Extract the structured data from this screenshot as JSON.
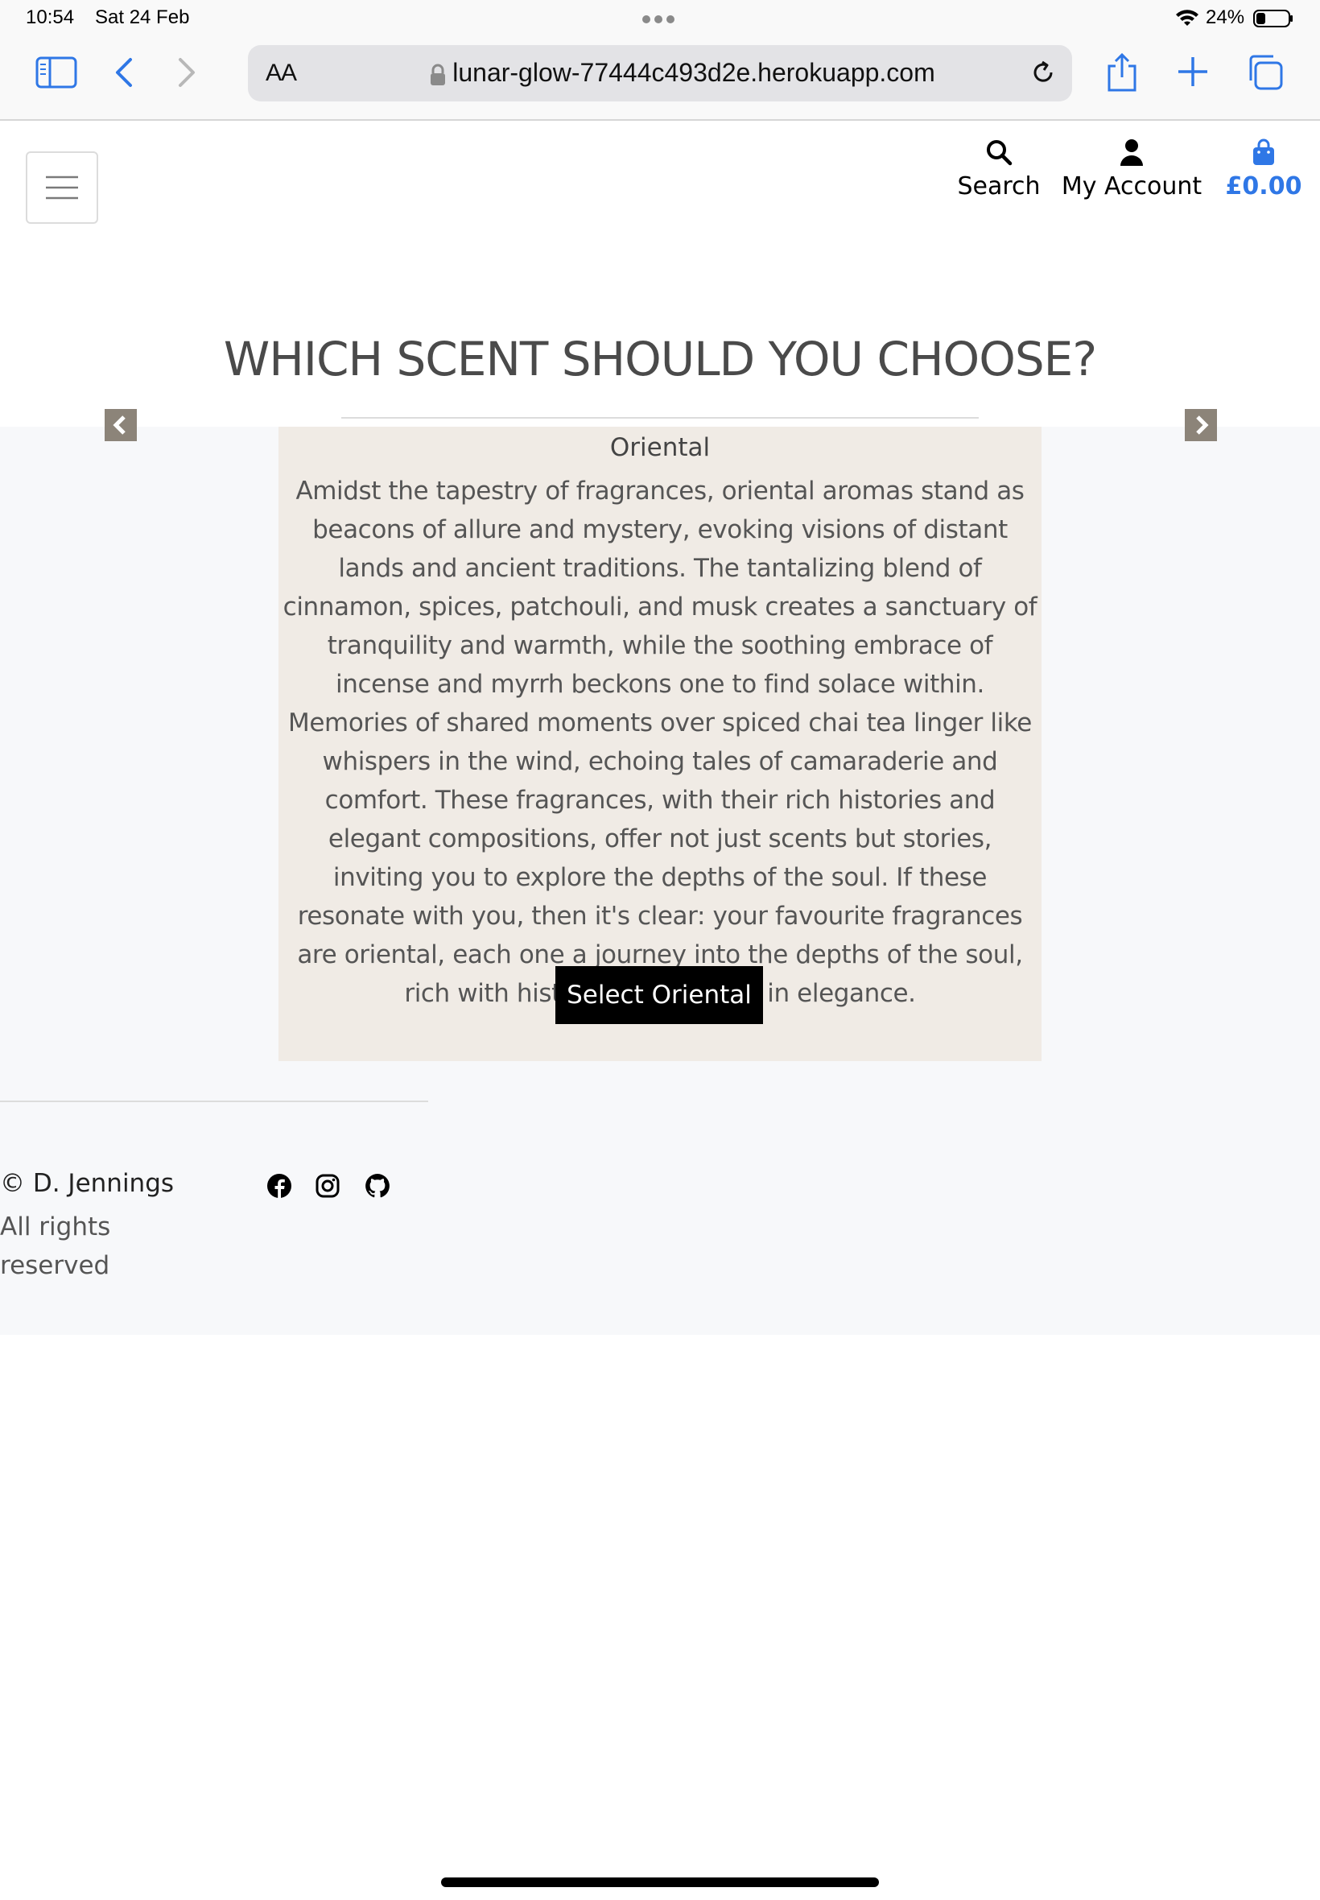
{
  "status": {
    "time": "10:54",
    "date": "Sat 24 Feb",
    "battery": "24%"
  },
  "browser": {
    "text_size_label": "AA",
    "url": "lunar-glow-77444c493d2e.herokuapp.com"
  },
  "header": {
    "search_label": "Search",
    "account_label": "My Account",
    "bag_total": "£0.00",
    "accent_color": "#2f77e6"
  },
  "main": {
    "title": "WHICH SCENT SHOULD YOU CHOOSE?",
    "card": {
      "name": "Oriental",
      "description": "Amidst the tapestry of fragrances, oriental aromas stand as beacons of allure and mystery, evoking visions of distant lands and ancient traditions. The tantalizing blend of cinnamon, spices, patchouli, and musk creates a sanctuary of tranquility and warmth, while the soothing embrace of incense and myrrh beckons one to find solace within. Memories of shared moments over spiced chai tea linger like whispers in the wind, echoing tales of camaraderie and comfort. These fragrances, with their rich histories and elegant compositions, offer not just scents but stories, inviting you to explore the depths of the soul. If these resonate with you, then it's clear: your favourite fragrances are oriental, each one a journey into the depths of the soul, rich with history and steeped in elegance.",
      "button_label": "Select Oriental"
    }
  },
  "footer": {
    "copyright": "© D. Jennings",
    "rights": "All rights reserved",
    "social_icons": [
      "facebook-icon",
      "instagram-icon",
      "github-icon"
    ]
  }
}
